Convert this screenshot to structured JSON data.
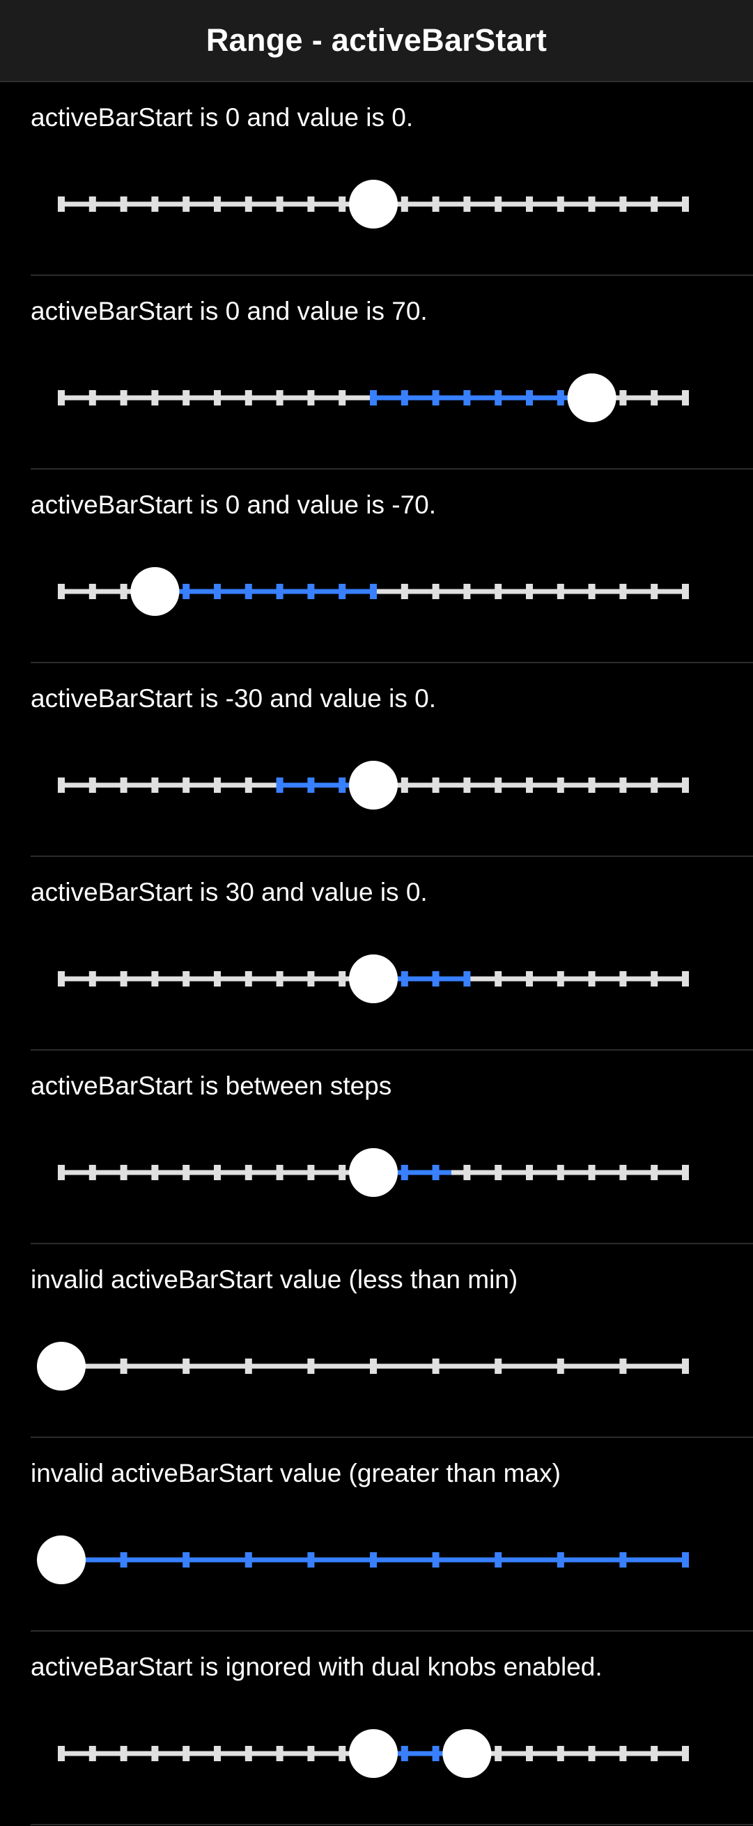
{
  "header": {
    "title": "Range - activeBarStart"
  },
  "colors": {
    "bar": "#e0e0e0",
    "active": "#3880ff",
    "knob": "#ffffff",
    "background": "#000000"
  },
  "ranges": [
    {
      "label": "activeBarStart is 0 and value is 0.",
      "min": -100,
      "max": 100,
      "step": 10,
      "ticks": true,
      "activeBarStart": 0,
      "value": 0
    },
    {
      "label": "activeBarStart is 0 and value is 70.",
      "min": -100,
      "max": 100,
      "step": 10,
      "ticks": true,
      "activeBarStart": 0,
      "value": 70
    },
    {
      "label": "activeBarStart is 0 and value is -70.",
      "min": -100,
      "max": 100,
      "step": 10,
      "ticks": true,
      "activeBarStart": 0,
      "value": -70
    },
    {
      "label": "activeBarStart is -30 and value is 0.",
      "min": -100,
      "max": 100,
      "step": 10,
      "ticks": true,
      "activeBarStart": -30,
      "value": 0
    },
    {
      "label": "activeBarStart is 30 and value is 0.",
      "min": -100,
      "max": 100,
      "step": 10,
      "ticks": true,
      "activeBarStart": 30,
      "value": 0
    },
    {
      "label": "activeBarStart is between steps",
      "min": -100,
      "max": 100,
      "step": 10,
      "ticks": true,
      "activeBarStart": 25,
      "value": 0
    },
    {
      "label": "invalid activeBarStart value (less than min)",
      "min": 0,
      "max": 100,
      "step": 10,
      "ticks": true,
      "activeBarStart": 0,
      "value": 0
    },
    {
      "label": "invalid activeBarStart value (greater than max)",
      "min": 0,
      "max": 100,
      "step": 10,
      "ticks": true,
      "activeBarStart": 100,
      "value": 0
    },
    {
      "label": "activeBarStart is ignored with dual knobs enabled.",
      "min": -100,
      "max": 100,
      "step": 10,
      "ticks": true,
      "dualKnobs": true,
      "lower": 0,
      "upper": 30
    }
  ]
}
